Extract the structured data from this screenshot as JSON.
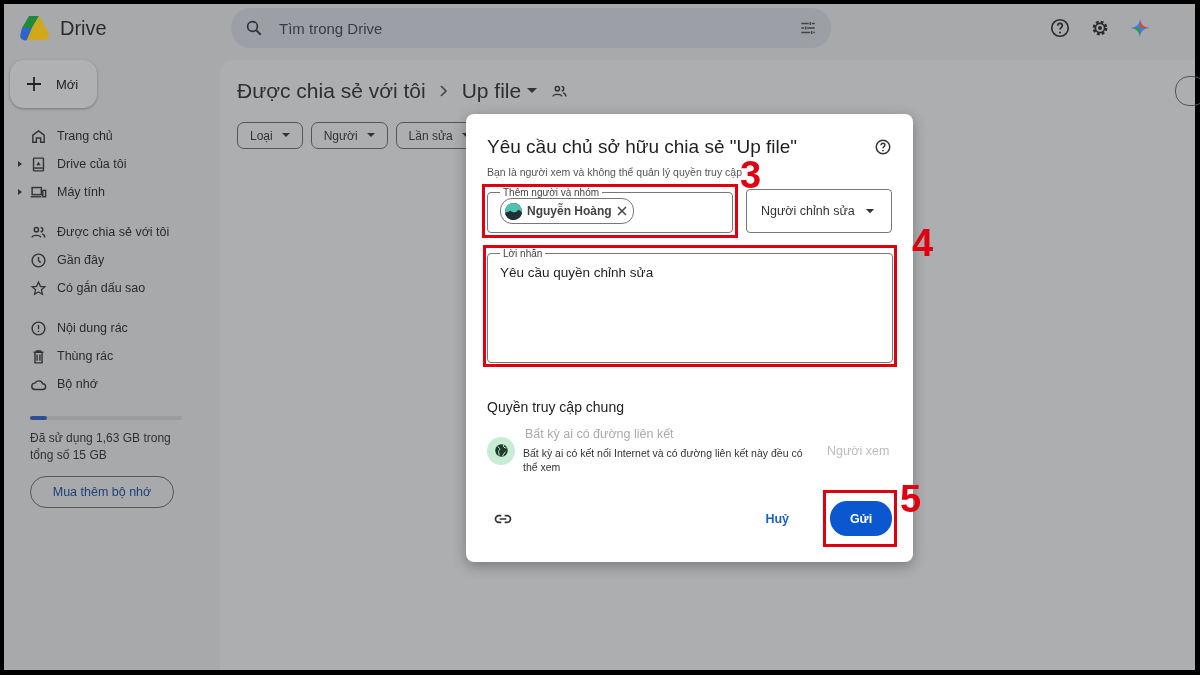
{
  "app": {
    "name": "Drive"
  },
  "search": {
    "placeholder": "Tìm trong Drive"
  },
  "new_button": "Mới",
  "sidebar": {
    "groups": [
      [
        {
          "label": "Trang chủ",
          "expandable": false
        },
        {
          "label": "Drive của tôi",
          "expandable": true
        },
        {
          "label": "Máy tính",
          "expandable": true
        }
      ],
      [
        {
          "label": "Được chia sẻ với tôi",
          "expandable": false
        },
        {
          "label": "Gần đây",
          "expandable": false
        },
        {
          "label": "Có gắn dấu sao",
          "expandable": false
        }
      ],
      [
        {
          "label": "Nội dung rác",
          "expandable": false
        },
        {
          "label": "Thùng rác",
          "expandable": false
        },
        {
          "label": "Bộ nhớ",
          "expandable": false
        }
      ]
    ],
    "storage": {
      "level": 0.11,
      "text": "Đã sử dụng 1,63 GB trong tổng số 15 GB",
      "button": "Mua thêm bộ nhớ"
    }
  },
  "breadcrumb": {
    "parent": "Được chia sẻ với tôi",
    "current": "Up file"
  },
  "filters": [
    "Loại",
    "Người",
    "Lần sửa"
  ],
  "dialog": {
    "title": "Yêu cầu chủ sở hữu chia sẻ \"Up file\"",
    "subtitle": "Bạn là người xem và không thể quản lý quyền truy cập",
    "people_field": {
      "label": "Thêm người và nhóm",
      "chips": [
        "Nguyễn Hoàng"
      ]
    },
    "role": "Người chỉnh sửa",
    "message": {
      "label": "Lời nhắn",
      "value": "Yêu cầu quyền chỉnh sửa"
    },
    "general_access": {
      "heading": "Quyền truy cập chung",
      "option": "Bất kỳ ai có đường liên kết",
      "description": "Bất kỳ ai có kết nối Internet và có đường liên kết này đều có thể xem",
      "role": "Người xem"
    },
    "cancel": "Huỷ",
    "send": "Gửi"
  },
  "annotations": [
    {
      "label": "3"
    },
    {
      "label": "4"
    },
    {
      "label": "5"
    }
  ]
}
